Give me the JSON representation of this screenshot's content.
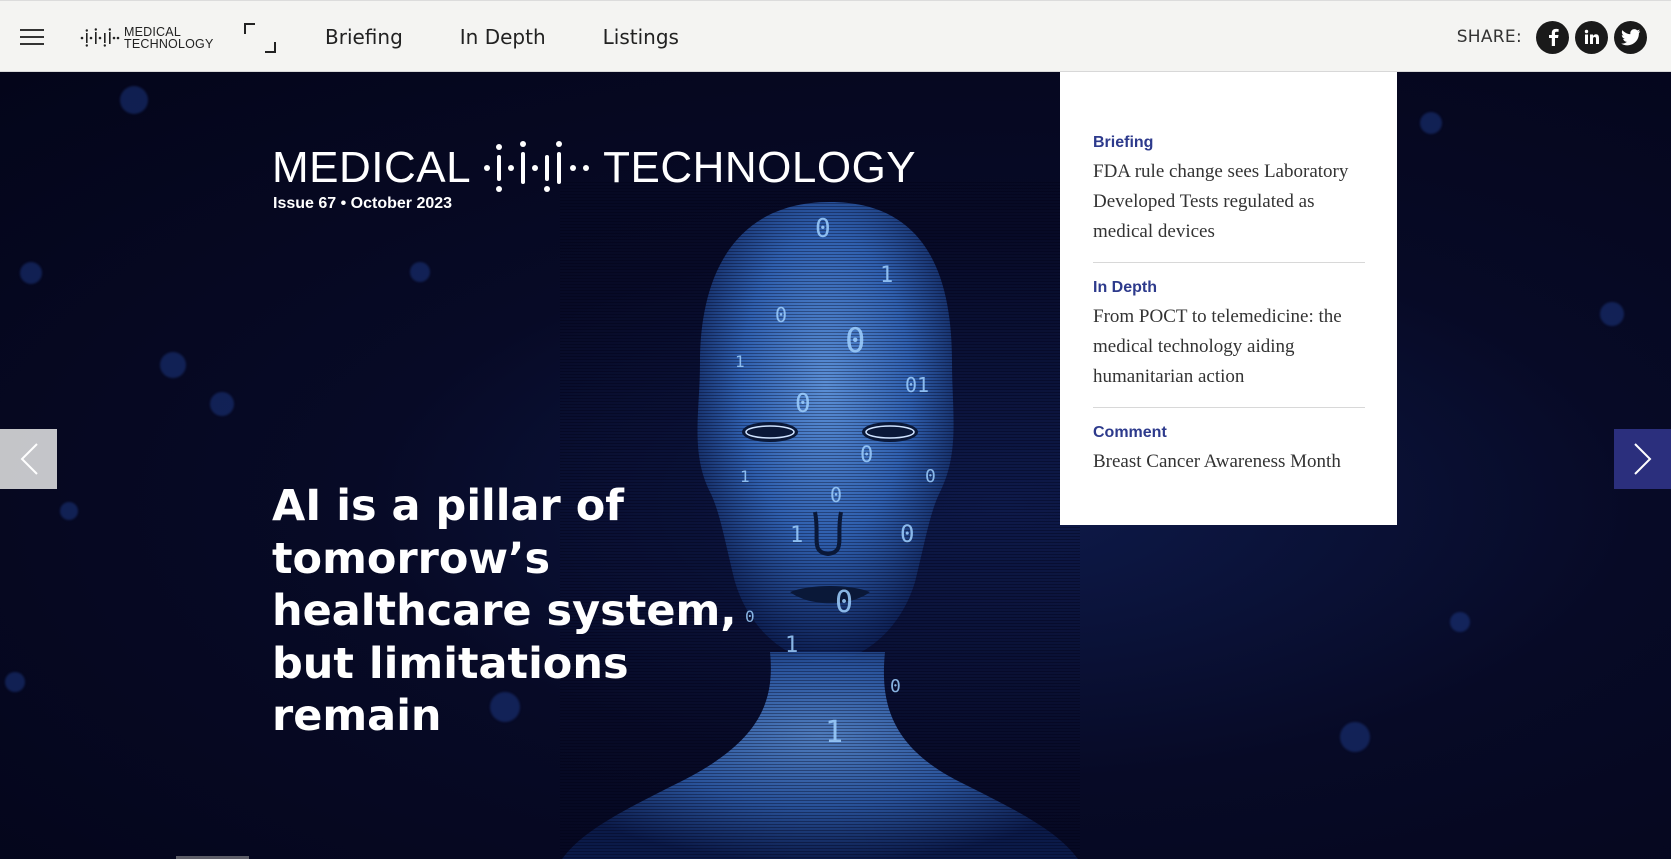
{
  "brand": {
    "line1": "MEDICAL",
    "line2": "TECHNOLOGY"
  },
  "nav": {
    "items": [
      "Briefing",
      "In Depth",
      "Listings"
    ]
  },
  "share": {
    "label": "SHARE:",
    "icons": [
      "facebook-icon",
      "linkedin-icon",
      "twitter-icon"
    ]
  },
  "hero": {
    "logo_left": "MEDICAL",
    "logo_right": "TECHNOLOGY",
    "issue": "Issue 67 • October 2023",
    "headline": "AI is a pillar of tomorrow’s healthcare system, but limitations remain"
  },
  "panel": {
    "items": [
      {
        "category": "Briefing",
        "title": "FDA rule change sees Laboratory Developed Tests regulated as medical devices"
      },
      {
        "category": "In Depth",
        "title": "From POCT to telemedicine: the medical technology aiding humanitarian action"
      },
      {
        "category": "Comment",
        "title": "Breast Cancer Awareness Month"
      }
    ]
  },
  "colors": {
    "accent": "#2d3a8c",
    "next_arrow": "#2b2f7d",
    "topbar": "#f4f4f2",
    "hero_bg": "#070a26"
  }
}
